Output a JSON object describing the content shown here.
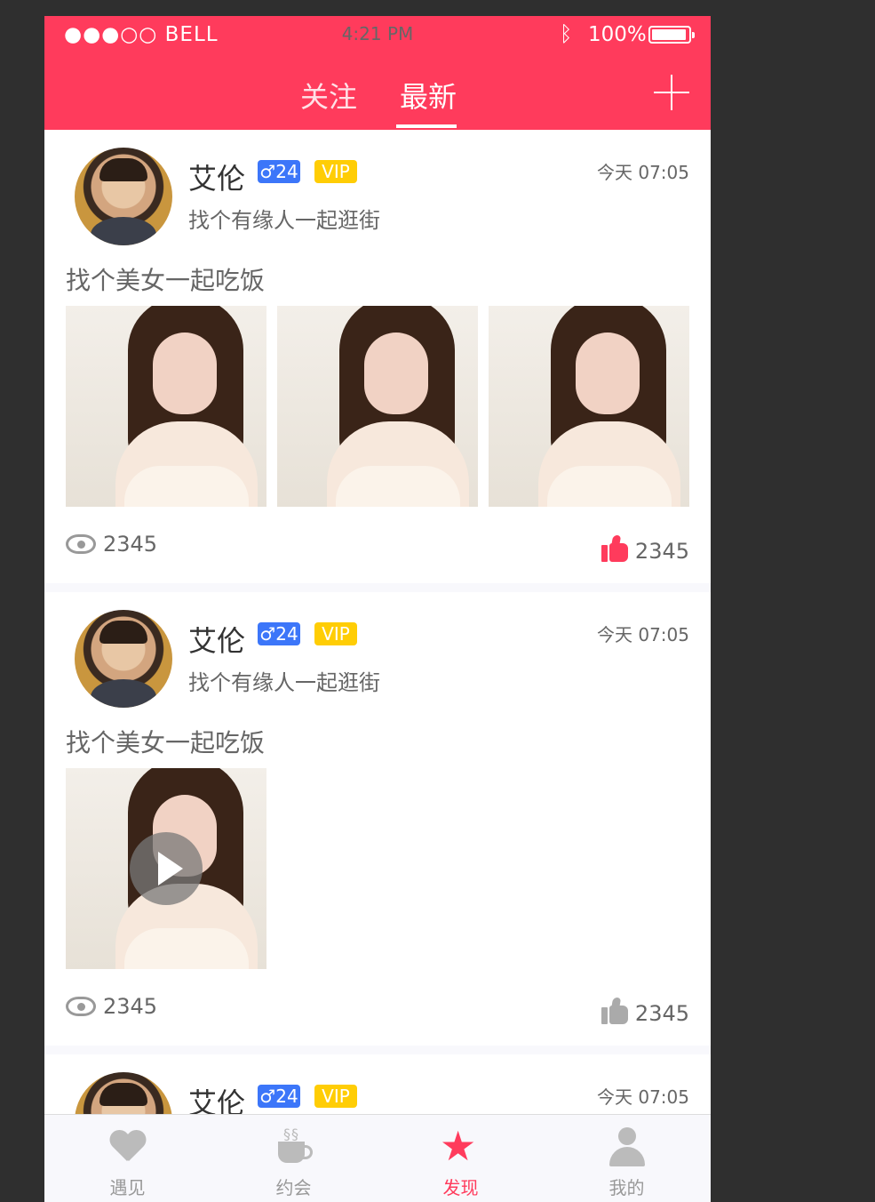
{
  "status_bar": {
    "carrier": "●●●○○ BELL",
    "time": "4:21 PM",
    "battery": "100%"
  },
  "header": {
    "tabs": [
      {
        "label": "关注"
      },
      {
        "label": "最新"
      }
    ],
    "active_tab": "最新"
  },
  "feed": [
    {
      "name": "艾伦",
      "gender_age": "♂24",
      "badge": "VIP",
      "time": "今天 07:05",
      "signature": "找个有缘人一起逛街",
      "text": "找个美女一起吃饭",
      "media": "photos",
      "photo_count": 3,
      "views": "2345",
      "likes": "2345",
      "liked": true
    },
    {
      "name": "艾伦",
      "gender_age": "♂24",
      "badge": "VIP",
      "time": "今天 07:05",
      "signature": "找个有缘人一起逛街",
      "text": "找个美女一起吃饭",
      "media": "video",
      "views": "2345",
      "likes": "2345",
      "liked": false
    },
    {
      "name": "艾伦",
      "gender_age": "♂24",
      "badge": "VIP",
      "time": "今天 07:05"
    }
  ],
  "tabbar": {
    "items": [
      {
        "label": "遇见",
        "icon": "heartbeat-icon"
      },
      {
        "label": "约会",
        "icon": "coffee-cup-icon"
      },
      {
        "label": "发现",
        "icon": "star-icon"
      },
      {
        "label": "我的",
        "icon": "person-icon"
      }
    ],
    "active": "发现"
  },
  "colors": {
    "brand": "#ff3b5c",
    "gender_badge": "#3c76f9",
    "vip_badge": "#ffcd05",
    "background": "#f8f8fc",
    "text_primary": "#333333",
    "text_secondary": "#666666"
  }
}
